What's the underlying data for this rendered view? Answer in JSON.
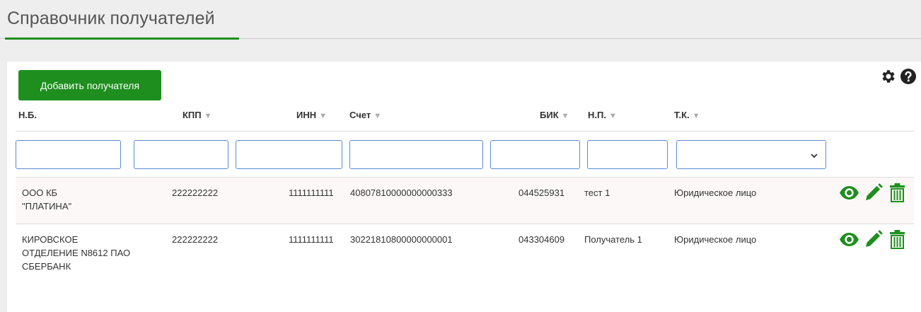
{
  "page": {
    "title": "Справочник получателей"
  },
  "toolbar": {
    "add_label": "Добавить получателя",
    "icons": [
      "gear-icon",
      "help-icon"
    ]
  },
  "columns": [
    {
      "key": "nb",
      "label": "Н.Б.",
      "sortable": false
    },
    {
      "key": "kpp",
      "label": "КПП",
      "sortable": true
    },
    {
      "key": "inn",
      "label": "ИНН",
      "sortable": true
    },
    {
      "key": "account",
      "label": "Счет",
      "sortable": true
    },
    {
      "key": "bik",
      "label": "БИК",
      "sortable": true
    },
    {
      "key": "np",
      "label": "Н.П.",
      "sortable": true
    },
    {
      "key": "tk",
      "label": "Т.К.",
      "sortable": true
    }
  ],
  "filters": {
    "nb": "",
    "kpp": "",
    "inn": "",
    "account": "",
    "bik": "",
    "np": "",
    "tk": ""
  },
  "rows": [
    {
      "nb": "ООО КБ \"ПЛАТИНА\"",
      "kpp": "222222222",
      "inn": "1111111111",
      "account": "40807810000000000333",
      "bik": "044525931",
      "np": "тест 1",
      "tk": "Юридическое лицо"
    },
    {
      "nb": "КИРОВСКОЕ ОТДЕЛЕНИЕ N8612 ПАО СБЕРБАНК",
      "kpp": "222222222",
      "inn": "1111111111",
      "account": "30221810800000000001",
      "bik": "043304609",
      "np": "Получатель 1",
      "tk": "Юридическое лицо"
    }
  ],
  "row_actions": [
    "view-icon",
    "edit-icon",
    "delete-icon"
  ],
  "colors": {
    "accent": "#1e8f1e",
    "filter_border": "#5a8bd0"
  }
}
